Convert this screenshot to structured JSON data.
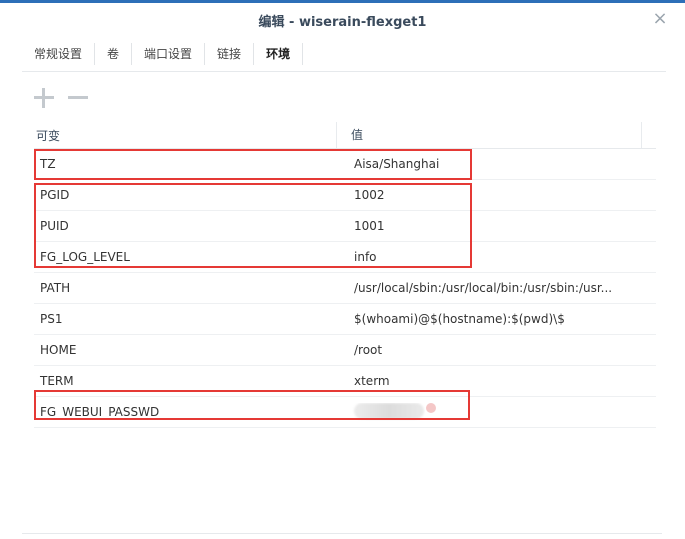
{
  "window": {
    "title": "编辑 - wiserain-flexget1",
    "close_symbol": "×"
  },
  "tabs": [
    {
      "label": "常规设置"
    },
    {
      "label": "卷"
    },
    {
      "label": "端口设置"
    },
    {
      "label": "链接"
    },
    {
      "label": "环境",
      "active": true
    }
  ],
  "toolbar": {
    "add_icon": "plus-icon",
    "remove_icon": "minus-icon"
  },
  "table": {
    "headers": [
      "可变",
      "值"
    ],
    "rows": [
      {
        "name": "TZ",
        "value": "Aisa/Shanghai"
      },
      {
        "name": "PGID",
        "value": "1002"
      },
      {
        "name": "PUID",
        "value": "1001"
      },
      {
        "name": "FG_LOG_LEVEL",
        "value": "info"
      },
      {
        "name": "PATH",
        "value": "/usr/local/sbin:/usr/local/bin:/usr/sbin:/usr..."
      },
      {
        "name": "PS1",
        "value": "$(whoami)@$(hostname):$(pwd)\\$"
      },
      {
        "name": "HOME",
        "value": "/root"
      },
      {
        "name": "TERM",
        "value": "xterm"
      },
      {
        "name": "FG_WEBUI_PASSWD",
        "value": ""
      }
    ]
  },
  "colors": {
    "accent": "#2d6fb8",
    "highlight": "#e53935"
  }
}
